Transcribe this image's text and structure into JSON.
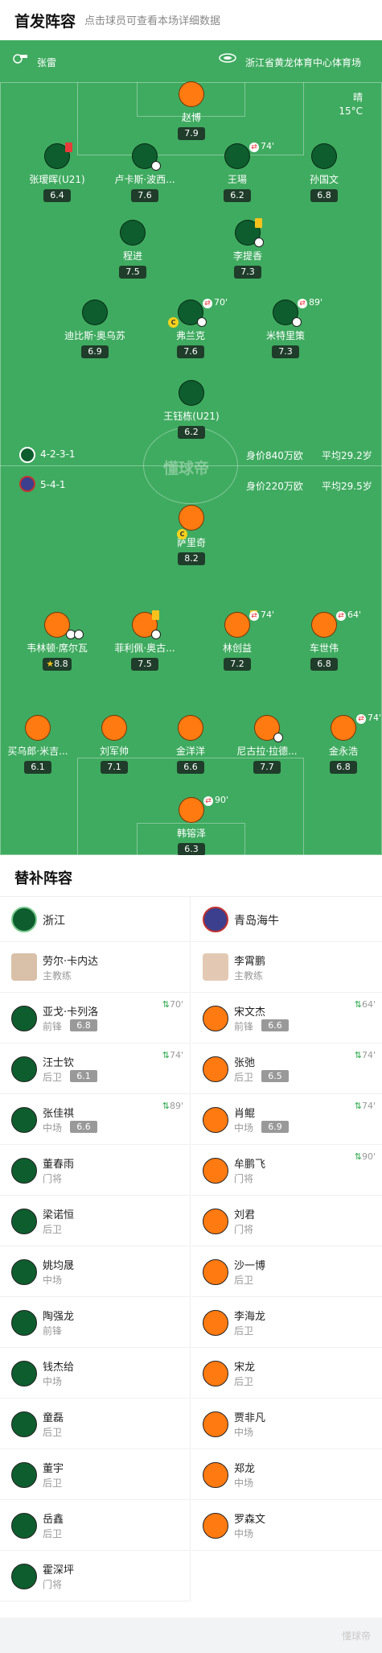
{
  "header": {
    "title": "首发阵容",
    "subtitle": "点击球员可查看本场详细数据"
  },
  "match_info": {
    "referee": "张雷",
    "stadium": "浙江省黄龙体育中心体育场",
    "weather": "晴",
    "temperature": "15°C"
  },
  "home": {
    "name": "浙江",
    "formation": "4-2-3-1",
    "market_value": "身价840万欧",
    "avg_age": "平均29.2岁",
    "coach": "劳尔·卡内达",
    "coach_role": "主教练",
    "players": [
      {
        "name": "赵博",
        "rating": "7.9"
      },
      {
        "name": "张瑷晖(U21)",
        "rating": "6.4"
      },
      {
        "name": "卢卡斯·波西...",
        "rating": "7.6"
      },
      {
        "name": "王瑒",
        "rating": "6.2",
        "sub_minute": "74'"
      },
      {
        "name": "孙国文",
        "rating": "6.8"
      },
      {
        "name": "程进",
        "rating": "7.5"
      },
      {
        "name": "李提香",
        "rating": "7.3"
      },
      {
        "name": "迪比斯·奥乌苏",
        "rating": "6.9"
      },
      {
        "name": "弗兰克",
        "rating": "7.6",
        "sub_minute": "70'"
      },
      {
        "name": "米特里策",
        "rating": "7.3",
        "sub_minute": "89'"
      },
      {
        "name": "王钰栋(U21)",
        "rating": "6.2"
      }
    ],
    "subs": [
      {
        "name": "亚戈·卡列洛",
        "position": "前锋",
        "rating": "6.8",
        "minute": "70'"
      },
      {
        "name": "汪士钦",
        "position": "后卫",
        "rating": "6.1",
        "minute": "74'"
      },
      {
        "name": "张佳祺",
        "position": "中场",
        "rating": "6.6",
        "minute": "89'"
      },
      {
        "name": "董春雨",
        "position": "门将"
      },
      {
        "name": "梁诺恒",
        "position": "后卫"
      },
      {
        "name": "姚均晟",
        "position": "中场"
      },
      {
        "name": "陶强龙",
        "position": "前锋"
      },
      {
        "name": "钱杰给",
        "position": "中场"
      },
      {
        "name": "童磊",
        "position": "后卫"
      },
      {
        "name": "董宇",
        "position": "后卫"
      },
      {
        "name": "岳鑫",
        "position": "后卫"
      },
      {
        "name": "霍深坪",
        "position": "门将"
      }
    ]
  },
  "away": {
    "name": "青岛海牛",
    "formation": "5-4-1",
    "market_value": "身价220万欧",
    "avg_age": "平均29.5岁",
    "coach": "李霄鹏",
    "coach_role": "主教练",
    "players": [
      {
        "name": "萨里奇",
        "rating": "8.2"
      },
      {
        "name": "韦林顿·席尔瓦",
        "rating": "8.8"
      },
      {
        "name": "菲利佩·奥古...",
        "rating": "7.5"
      },
      {
        "name": "林创益",
        "rating": "7.2",
        "sub_minute": "74'"
      },
      {
        "name": "车世伟",
        "rating": "6.8",
        "sub_minute": "64'"
      },
      {
        "name": "买乌郎·米吉...",
        "rating": "6.1"
      },
      {
        "name": "刘军帅",
        "rating": "7.1"
      },
      {
        "name": "金洋洋",
        "rating": "6.6"
      },
      {
        "name": "尼古拉·拉德...",
        "rating": "7.7"
      },
      {
        "name": "金永浩",
        "rating": "6.8",
        "sub_minute": "74'"
      },
      {
        "name": "韩镕泽",
        "rating": "6.3",
        "sub_minute": "90'"
      }
    ],
    "subs": [
      {
        "name": "宋文杰",
        "position": "前锋",
        "rating": "6.6",
        "minute": "64'"
      },
      {
        "name": "张弛",
        "position": "后卫",
        "rating": "6.5",
        "minute": "74'"
      },
      {
        "name": "肖鲲",
        "position": "中场",
        "rating": "6.9",
        "minute": "74'"
      },
      {
        "name": "牟鹏飞",
        "position": "门将",
        "minute": "90'"
      },
      {
        "name": "刘君",
        "position": "门将"
      },
      {
        "name": "沙一博",
        "position": "后卫"
      },
      {
        "name": "李海龙",
        "position": "后卫"
      },
      {
        "name": "宋龙",
        "position": "后卫"
      },
      {
        "name": "贾非凡",
        "position": "中场"
      },
      {
        "name": "郑龙",
        "position": "中场"
      },
      {
        "name": "罗森文",
        "position": "中场"
      }
    ]
  },
  "subs_section_title": "替补阵容",
  "watermark": "懂球帝",
  "colors": {
    "pitch": "#3fab60",
    "home_shirt": "#0e5d2e",
    "away_shirt": "#ff7a11"
  }
}
